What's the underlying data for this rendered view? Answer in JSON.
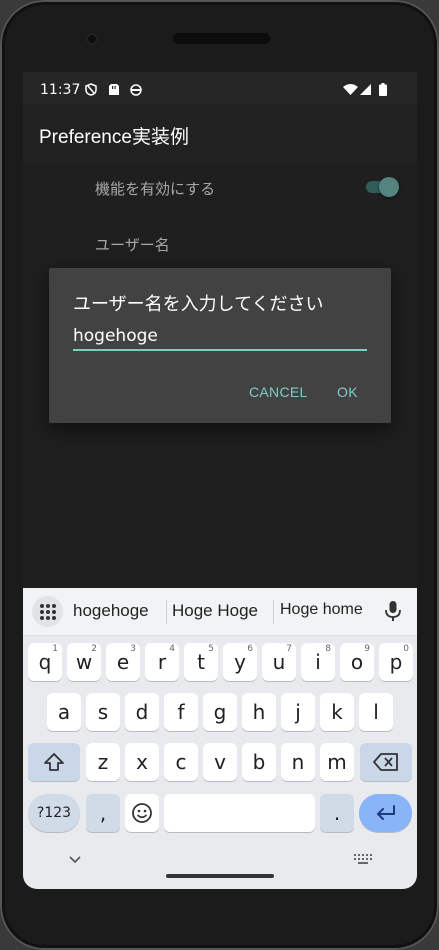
{
  "status_bar": {
    "time": "11:37"
  },
  "app_bar": {
    "title": "Preference実装例"
  },
  "preferences": {
    "enable_label": "機能を有効にする",
    "enable_on": true,
    "username_label": "ユーザー名"
  },
  "dialog": {
    "title": "ユーザー名を入力してください",
    "input_value": "hogehoge",
    "cancel_label": "CANCEL",
    "ok_label": "OK"
  },
  "keyboard": {
    "suggestions": [
      "hogehoge",
      "Hoge Hoge",
      "Hoge home"
    ],
    "row1": [
      {
        "k": "q",
        "n": "1"
      },
      {
        "k": "w",
        "n": "2"
      },
      {
        "k": "e",
        "n": "3"
      },
      {
        "k": "r",
        "n": "4"
      },
      {
        "k": "t",
        "n": "5"
      },
      {
        "k": "y",
        "n": "6"
      },
      {
        "k": "u",
        "n": "7"
      },
      {
        "k": "i",
        "n": "8"
      },
      {
        "k": "o",
        "n": "9"
      },
      {
        "k": "p",
        "n": "0"
      }
    ],
    "row2": [
      "a",
      "s",
      "d",
      "f",
      "g",
      "h",
      "j",
      "k",
      "l"
    ],
    "row3": [
      "z",
      "x",
      "c",
      "v",
      "b",
      "n",
      "m"
    ],
    "sym_label": "?123",
    "comma_label": ",",
    "period_label": "."
  },
  "colors": {
    "accent": "#80cbc4",
    "enter": "#8ab4f8"
  },
  "icons": [
    "dnd-icon",
    "sim-icon",
    "android-icon",
    "wifi-icon",
    "signal-icon",
    "battery-icon",
    "mic-icon",
    "apps-grid-icon",
    "shift-icon",
    "backspace-icon",
    "emoji-icon",
    "enter-icon",
    "keyboard-hide-icon",
    "keyboard-switch-icon"
  ]
}
